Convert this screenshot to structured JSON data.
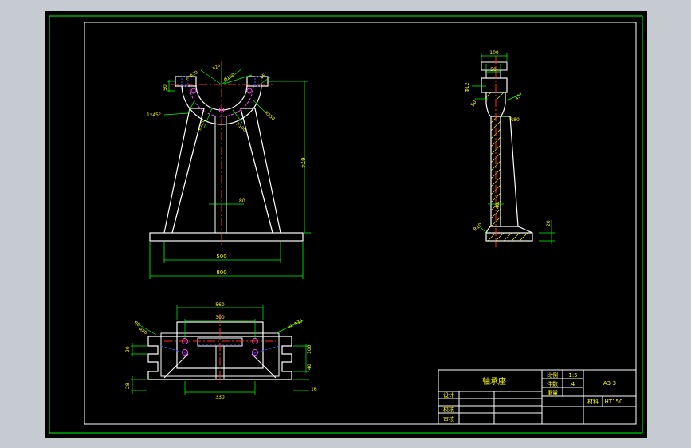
{
  "colors": {
    "background": "#c6cbd1",
    "model_space": "#000000",
    "border": "#00ff00",
    "geometry": "#ffffff",
    "dimension": "#00ff00",
    "hidden": "#3a4cff",
    "centerline": "#ff2a1a",
    "hole": "#ff40ff",
    "hatch": "#ffff00",
    "text": "#ffff00",
    "title_lines": "#ffffff"
  },
  "title_block": {
    "part_name": "轴承座",
    "scale_label": "比例",
    "scale_value": "1:5",
    "qty_label": "件数",
    "qty_value": "4",
    "weight_label": "重量",
    "drawing_no": "A3-3",
    "material_label": "材料",
    "material_value": "HT150",
    "design_label": "设计",
    "check_label": "校核",
    "review_label": "审核"
  },
  "front_view": {
    "dim_overall_width": "800",
    "dim_leg_width": "500",
    "dim_height": "674",
    "dim_web": "80",
    "dim_top_left": "50",
    "dim_chamfer": "1x45°",
    "dim_r_inner": "R220",
    "dim_r_outer": "R250",
    "dim_hole_top": "2-Φ20",
    "dim_hole_top2": "Φ160",
    "dim_r_web": "R100",
    "dim_r_web2": "R20",
    "dim_angle": "45°"
  },
  "side_view": {
    "dim_top_width": "100",
    "dim_slot": "50",
    "dim_bore": "Φ12",
    "dim_step": "50",
    "dim_r": "R80",
    "dim_angle": "45°",
    "dim_web": "40",
    "dim_bottom_r": "R10",
    "dim_base_height": "20"
  },
  "top_view": {
    "dim_width": "560",
    "dim_inner": "300",
    "dim_bottom": "330",
    "dim_left": "80",
    "dim_left2": "20",
    "dim_right": "4x Φ30",
    "dim_right_h": "100",
    "dim_right_h2": "40",
    "dim_right_w": "16",
    "dim_left_small": "28",
    "dim_left_r": "R80"
  }
}
